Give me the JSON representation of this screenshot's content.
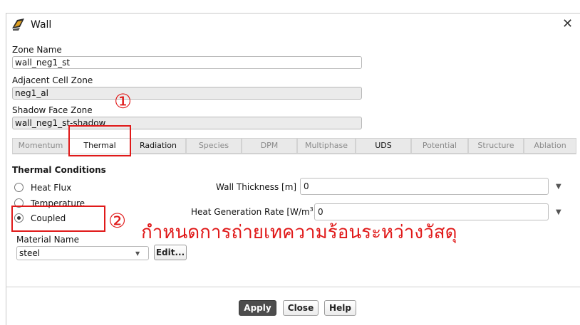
{
  "window": {
    "title": "Wall",
    "close_glyph": "✕"
  },
  "fields": {
    "zone_name": {
      "label": "Zone Name",
      "value": "wall_neg1_st"
    },
    "adjacent_cell_zone": {
      "label": "Adjacent Cell Zone",
      "value": "neg1_al"
    },
    "shadow_face_zone": {
      "label": "Shadow Face Zone",
      "value": "wall_neg1_st-shadow"
    }
  },
  "tabs": [
    "Momentum",
    "Thermal",
    "Radiation",
    "Species",
    "DPM",
    "Multiphase",
    "UDS",
    "Potential",
    "Structure",
    "Ablation"
  ],
  "selected_tab": "Thermal",
  "thermal": {
    "group_title": "Thermal Conditions",
    "radios": [
      "Heat Flux",
      "Temperature",
      "Coupled"
    ],
    "selected_radio": "Coupled",
    "wall_thickness": {
      "label": "Wall Thickness [m]",
      "value": "0"
    },
    "heat_generation": {
      "label_prefix": "Heat Generation Rate [W/m",
      "label_sup": "3",
      "label_suffix": "]",
      "value": "0"
    },
    "material": {
      "label": "Material Name",
      "value": "steel",
      "edit_label": "Edit..."
    }
  },
  "buttons": {
    "apply": "Apply",
    "close": "Close",
    "help": "Help"
  },
  "annotations": {
    "marker1": "①",
    "marker2": "②",
    "thai_text": "กำหนดการถ่ายเทความร้อนระหว่างวัสดุ",
    "color": "#e01919"
  }
}
